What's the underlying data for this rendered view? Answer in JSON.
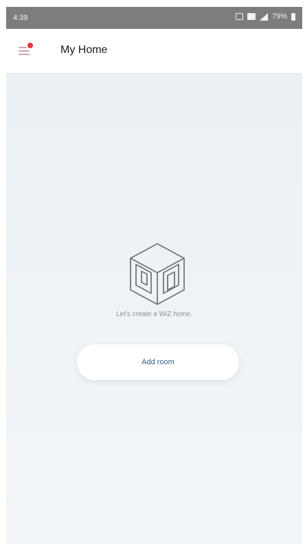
{
  "status_bar": {
    "time": "4:39",
    "battery": "79%"
  },
  "header": {
    "title": "My Home",
    "menu_icon": "hamburger-menu-icon",
    "notification_dot_color": "#e53935"
  },
  "empty_state": {
    "illustration_icon": "room-cube-icon",
    "message": "Let's create a WiZ home.",
    "add_room_label": "Add room"
  },
  "colors": {
    "accent_text": "#2f5f8f",
    "status_bar_bg": "#7d7d7d"
  }
}
